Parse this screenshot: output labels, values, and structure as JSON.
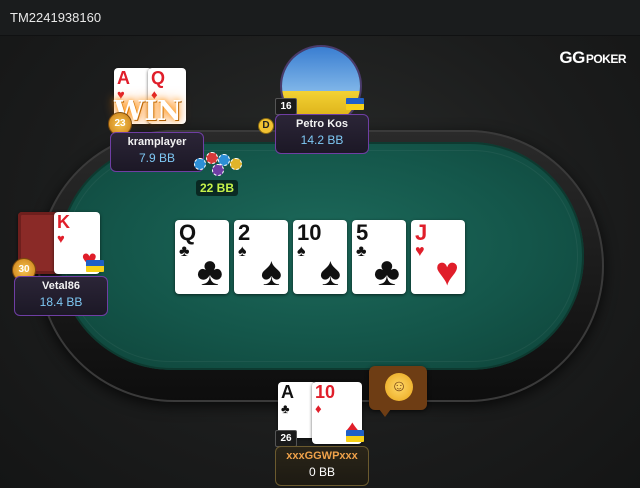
{
  "header": {
    "table_id": "TM2241938160"
  },
  "brand": {
    "logo_main": "GG",
    "logo_sub": "POKER"
  },
  "board": [
    {
      "rank": "Q",
      "suit": "♣",
      "color": "black"
    },
    {
      "rank": "2",
      "suit": "♠",
      "color": "black"
    },
    {
      "rank": "10",
      "suit": "♠",
      "color": "black"
    },
    {
      "rank": "5",
      "suit": "♣",
      "color": "black"
    },
    {
      "rank": "J",
      "suit": "♥",
      "color": "red"
    }
  ],
  "players": {
    "top_left": {
      "name": "kramplayer",
      "stack": "7.9 BB",
      "level": "23",
      "status": "WIN",
      "bet": "22 BB",
      "cards": [
        {
          "rank": "A",
          "suit": "♥"
        },
        {
          "rank": "Q",
          "suit": "♦"
        }
      ]
    },
    "top_center": {
      "name": "Petro Kos",
      "stack": "14.2 BB",
      "level": "16",
      "dealer": "D"
    },
    "left": {
      "name": "Vetal86",
      "stack": "18.4 BB",
      "level": "30",
      "cards": [
        {
          "rank": "K",
          "suit": "♥"
        }
      ]
    },
    "bottom": {
      "name": "xxxGGWPxxx",
      "stack": "0 BB",
      "level": "26",
      "cards": [
        {
          "rank": "A",
          "suit": "♣"
        },
        {
          "rank": "10",
          "suit": "♦"
        }
      ]
    }
  },
  "colors": {
    "felt": "#14564a",
    "plate_border": "#6f3ea4",
    "stack_text": "#7ec8f4",
    "bet_text": "#c6f24a",
    "win_glow": "#ff9d1a",
    "flag_blue": "#1f5fc6",
    "flag_yellow": "#f7d117"
  },
  "icons": {
    "emote": "smiley-emote-icon",
    "dealer": "dealer-button-icon",
    "flag": "ukraine-flag-icon"
  }
}
